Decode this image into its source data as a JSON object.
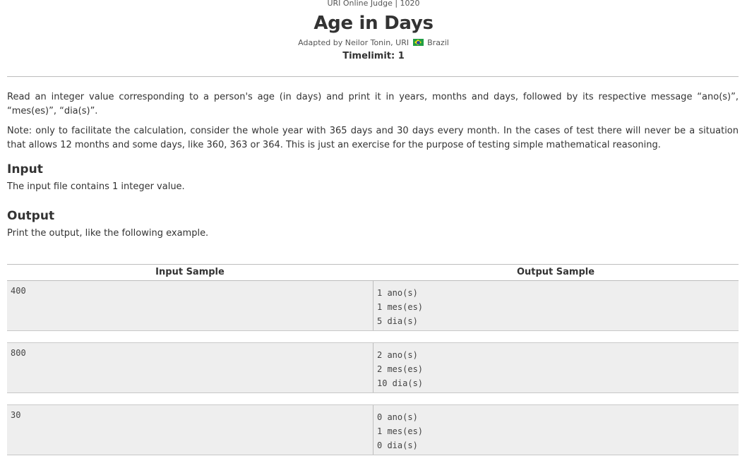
{
  "header": {
    "judge_line": "URI Online Judge | 1020",
    "title": "Age in Days",
    "adapted_by": "Adapted by Neilor Tonin, URI",
    "country": "Brazil",
    "timelimit": "Timelimit: 1"
  },
  "description": {
    "paragraph1": "Read an integer value corresponding to a person's age (in days) and print it in years, months and days, followed by its respective message “ano(s)”, “mes(es)”, “dia(s)”.",
    "paragraph2": "Note: only to facilitate the calculation, consider the whole year with 365 days and 30 days every month. In the cases of test there will never be a situation that allows 12 months and some days, like 360, 363 or 364. This is just an exercise for the purpose of testing simple mathematical reasoning."
  },
  "input_section": {
    "heading": "Input",
    "text": "The input file contains 1 integer value."
  },
  "output_section": {
    "heading": "Output",
    "text": "Print the output, like the following example."
  },
  "samples": {
    "input_header": "Input Sample",
    "output_header": "Output Sample",
    "rows": [
      {
        "input": "400",
        "output": [
          "1 ano(s)",
          "1 mes(es)",
          "5 dia(s)"
        ]
      },
      {
        "input": "800",
        "output": [
          "2 ano(s)",
          "2 mes(es)",
          "10 dia(s)"
        ]
      },
      {
        "input": "30",
        "output": [
          "0 ano(s)",
          "1 mes(es)",
          "0 dia(s)"
        ]
      }
    ]
  },
  "icons": {
    "flag": "brazil-flag-icon"
  },
  "colors": {
    "text": "#333333",
    "sample_background": "#eeeeee",
    "divider": "#bdbdbd"
  }
}
